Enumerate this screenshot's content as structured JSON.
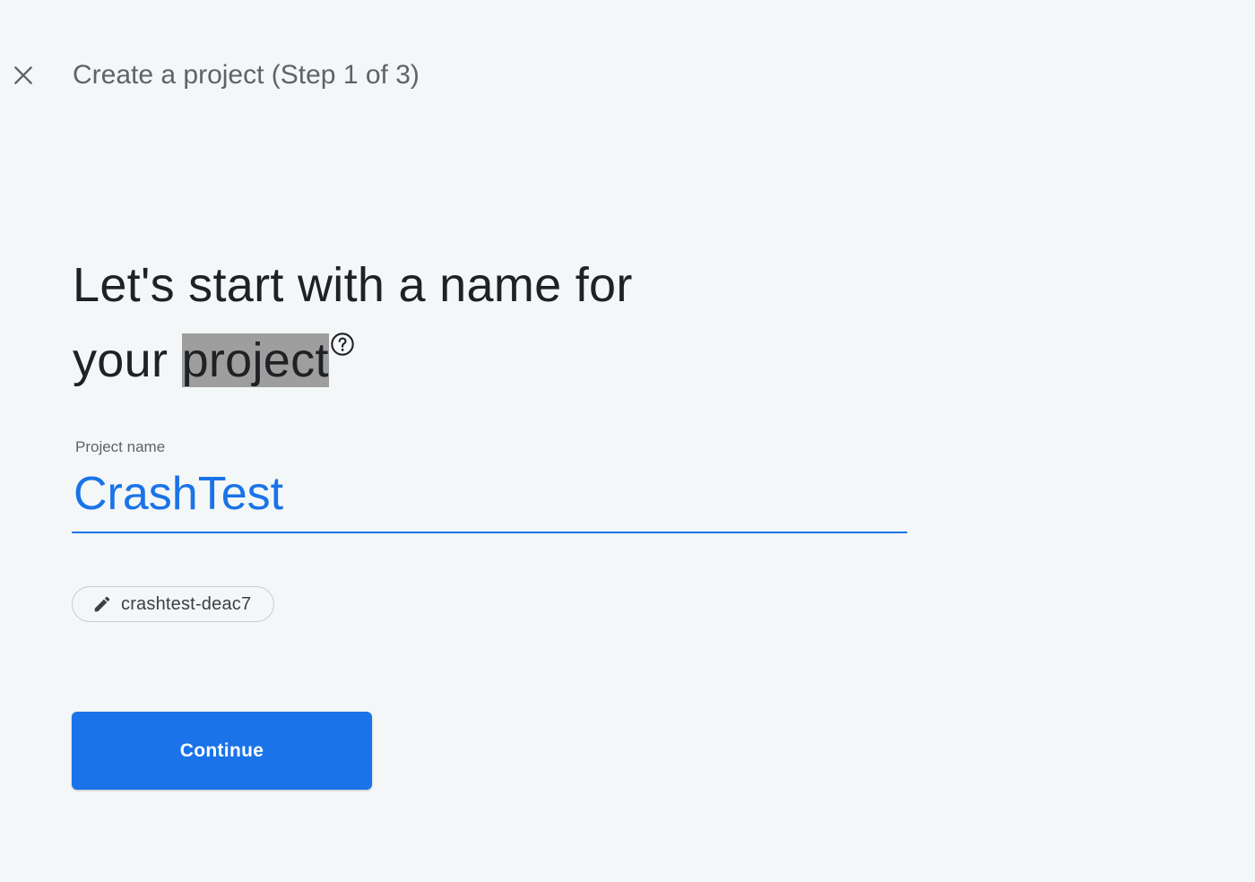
{
  "header": {
    "close_icon": "close-icon",
    "title": "Create a project (Step 1 of 3)"
  },
  "headline": {
    "line1": "Let's start with a name for",
    "line2_prefix": "your ",
    "line2_highlight": "project",
    "help_icon": "help-circle-icon"
  },
  "project_name_field": {
    "label": "Project name",
    "value": "CrashTest"
  },
  "project_id_chip": {
    "icon": "pencil-icon",
    "value": "crashtest-deac7"
  },
  "actions": {
    "continue_label": "Continue"
  },
  "colors": {
    "accent": "#1a73e8",
    "background": "#f4f7f8",
    "text_primary": "#202124",
    "text_secondary": "#5f6368",
    "highlight": "#9e9e9e"
  }
}
